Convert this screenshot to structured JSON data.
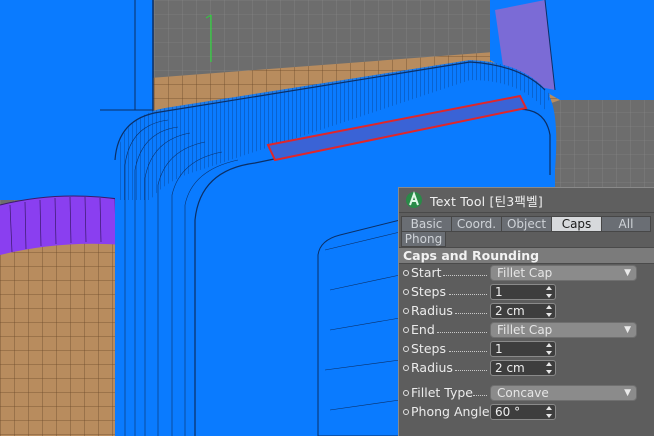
{
  "panel": {
    "title": "Text Tool [틴3팩벨]",
    "tabs": [
      {
        "label": "Basic"
      },
      {
        "label": "Coord."
      },
      {
        "label": "Object"
      },
      {
        "label": "Caps"
      },
      {
        "label": "All"
      },
      {
        "label": "Phong"
      }
    ],
    "active_tab": "Caps",
    "section_title": "Caps and Rounding",
    "fields": {
      "start": {
        "label": "Start",
        "value": "Fillet Cap"
      },
      "steps1": {
        "label": "Steps",
        "value": "1"
      },
      "radius1": {
        "label": "Radius",
        "value": "2 cm"
      },
      "end": {
        "label": "End",
        "value": "Fillet Cap"
      },
      "steps2": {
        "label": "Steps",
        "value": "1"
      },
      "radius2": {
        "label": "Radius",
        "value": "2 cm"
      },
      "fillet_type": {
        "label": "Fillet Type",
        "value": "Concave"
      },
      "phong_angle": {
        "label": "Phong Angle",
        "value": "60 °"
      }
    }
  },
  "colors": {
    "object_blue": "#0a7bff",
    "selection_red": "#e0262a",
    "purple": "#8a3ff0",
    "wood_floor": "#b88c5e",
    "panel_bg": "#5d5d5d",
    "active_tab": "#d7d9dc",
    "logo_green": "#3fd16b"
  },
  "icons": {
    "logo": "cinema4d-logo-icon",
    "dropdown_arrow": "dropdown-arrow-icon",
    "spinner": "spinner-arrows-icon"
  }
}
